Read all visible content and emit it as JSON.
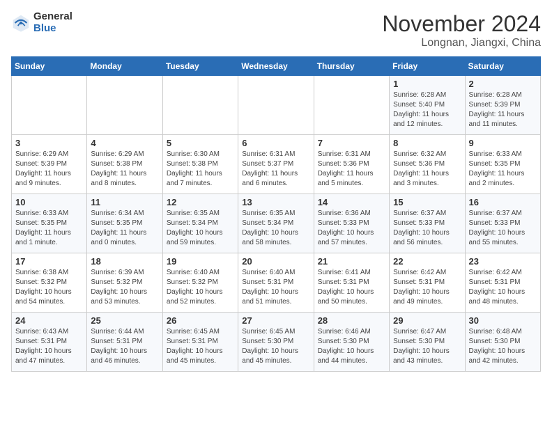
{
  "logo": {
    "general": "General",
    "blue": "Blue"
  },
  "header": {
    "month": "November 2024",
    "location": "Longnan, Jiangxi, China"
  },
  "weekdays": [
    "Sunday",
    "Monday",
    "Tuesday",
    "Wednesday",
    "Thursday",
    "Friday",
    "Saturday"
  ],
  "weeks": [
    [
      {
        "day": "",
        "info": ""
      },
      {
        "day": "",
        "info": ""
      },
      {
        "day": "",
        "info": ""
      },
      {
        "day": "",
        "info": ""
      },
      {
        "day": "",
        "info": ""
      },
      {
        "day": "1",
        "info": "Sunrise: 6:28 AM\nSunset: 5:40 PM\nDaylight: 11 hours and 12 minutes."
      },
      {
        "day": "2",
        "info": "Sunrise: 6:28 AM\nSunset: 5:39 PM\nDaylight: 11 hours and 11 minutes."
      }
    ],
    [
      {
        "day": "3",
        "info": "Sunrise: 6:29 AM\nSunset: 5:39 PM\nDaylight: 11 hours and 9 minutes."
      },
      {
        "day": "4",
        "info": "Sunrise: 6:29 AM\nSunset: 5:38 PM\nDaylight: 11 hours and 8 minutes."
      },
      {
        "day": "5",
        "info": "Sunrise: 6:30 AM\nSunset: 5:38 PM\nDaylight: 11 hours and 7 minutes."
      },
      {
        "day": "6",
        "info": "Sunrise: 6:31 AM\nSunset: 5:37 PM\nDaylight: 11 hours and 6 minutes."
      },
      {
        "day": "7",
        "info": "Sunrise: 6:31 AM\nSunset: 5:36 PM\nDaylight: 11 hours and 5 minutes."
      },
      {
        "day": "8",
        "info": "Sunrise: 6:32 AM\nSunset: 5:36 PM\nDaylight: 11 hours and 3 minutes."
      },
      {
        "day": "9",
        "info": "Sunrise: 6:33 AM\nSunset: 5:35 PM\nDaylight: 11 hours and 2 minutes."
      }
    ],
    [
      {
        "day": "10",
        "info": "Sunrise: 6:33 AM\nSunset: 5:35 PM\nDaylight: 11 hours and 1 minute."
      },
      {
        "day": "11",
        "info": "Sunrise: 6:34 AM\nSunset: 5:35 PM\nDaylight: 11 hours and 0 minutes."
      },
      {
        "day": "12",
        "info": "Sunrise: 6:35 AM\nSunset: 5:34 PM\nDaylight: 10 hours and 59 minutes."
      },
      {
        "day": "13",
        "info": "Sunrise: 6:35 AM\nSunset: 5:34 PM\nDaylight: 10 hours and 58 minutes."
      },
      {
        "day": "14",
        "info": "Sunrise: 6:36 AM\nSunset: 5:33 PM\nDaylight: 10 hours and 57 minutes."
      },
      {
        "day": "15",
        "info": "Sunrise: 6:37 AM\nSunset: 5:33 PM\nDaylight: 10 hours and 56 minutes."
      },
      {
        "day": "16",
        "info": "Sunrise: 6:37 AM\nSunset: 5:33 PM\nDaylight: 10 hours and 55 minutes."
      }
    ],
    [
      {
        "day": "17",
        "info": "Sunrise: 6:38 AM\nSunset: 5:32 PM\nDaylight: 10 hours and 54 minutes."
      },
      {
        "day": "18",
        "info": "Sunrise: 6:39 AM\nSunset: 5:32 PM\nDaylight: 10 hours and 53 minutes."
      },
      {
        "day": "19",
        "info": "Sunrise: 6:40 AM\nSunset: 5:32 PM\nDaylight: 10 hours and 52 minutes."
      },
      {
        "day": "20",
        "info": "Sunrise: 6:40 AM\nSunset: 5:31 PM\nDaylight: 10 hours and 51 minutes."
      },
      {
        "day": "21",
        "info": "Sunrise: 6:41 AM\nSunset: 5:31 PM\nDaylight: 10 hours and 50 minutes."
      },
      {
        "day": "22",
        "info": "Sunrise: 6:42 AM\nSunset: 5:31 PM\nDaylight: 10 hours and 49 minutes."
      },
      {
        "day": "23",
        "info": "Sunrise: 6:42 AM\nSunset: 5:31 PM\nDaylight: 10 hours and 48 minutes."
      }
    ],
    [
      {
        "day": "24",
        "info": "Sunrise: 6:43 AM\nSunset: 5:31 PM\nDaylight: 10 hours and 47 minutes."
      },
      {
        "day": "25",
        "info": "Sunrise: 6:44 AM\nSunset: 5:31 PM\nDaylight: 10 hours and 46 minutes."
      },
      {
        "day": "26",
        "info": "Sunrise: 6:45 AM\nSunset: 5:31 PM\nDaylight: 10 hours and 45 minutes."
      },
      {
        "day": "27",
        "info": "Sunrise: 6:45 AM\nSunset: 5:30 PM\nDaylight: 10 hours and 45 minutes."
      },
      {
        "day": "28",
        "info": "Sunrise: 6:46 AM\nSunset: 5:30 PM\nDaylight: 10 hours and 44 minutes."
      },
      {
        "day": "29",
        "info": "Sunrise: 6:47 AM\nSunset: 5:30 PM\nDaylight: 10 hours and 43 minutes."
      },
      {
        "day": "30",
        "info": "Sunrise: 6:48 AM\nSunset: 5:30 PM\nDaylight: 10 hours and 42 minutes."
      }
    ]
  ]
}
